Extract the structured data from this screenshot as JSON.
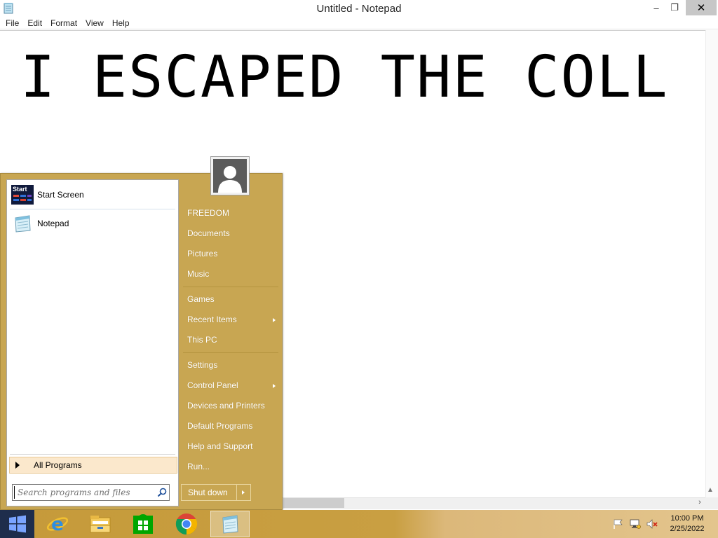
{
  "window": {
    "title": "Untitled - Notepad",
    "icon": "notepad-icon",
    "minimize_glyph": "–",
    "restore_glyph": "❐",
    "close_glyph": "✕"
  },
  "menubar": {
    "items": [
      "File",
      "Edit",
      "Format",
      "View",
      "Help"
    ]
  },
  "editor": {
    "text": "I ESCAPED THE COLL"
  },
  "start_menu": {
    "pinned": [
      {
        "label": "Start Screen",
        "icon": "start-screen-icon",
        "icon_text": "Start"
      },
      {
        "label": "Notepad",
        "icon": "notepad-icon"
      }
    ],
    "all_programs": "All Programs",
    "search": {
      "placeholder": "Search programs and files",
      "value": ""
    },
    "user_icon": "user-avatar-icon",
    "right_items": [
      {
        "label": "FREEDOM",
        "submenu": false
      },
      {
        "label": "Documents",
        "submenu": false
      },
      {
        "label": "Pictures",
        "submenu": false
      },
      {
        "label": "Music",
        "submenu": false
      },
      {
        "label": "Games",
        "submenu": false
      },
      {
        "label": "Recent Items",
        "submenu": true
      },
      {
        "label": "This PC",
        "submenu": false
      },
      {
        "label": "Settings",
        "submenu": false
      },
      {
        "label": "Control Panel",
        "submenu": true
      },
      {
        "label": "Devices and Printers",
        "submenu": false
      },
      {
        "label": "Default Programs",
        "submenu": false
      },
      {
        "label": "Help and Support",
        "submenu": false
      },
      {
        "label": "Run...",
        "submenu": false
      }
    ],
    "shutdown_label": "Shut down"
  },
  "taskbar": {
    "start_icon": "windows-logo-icon",
    "pinned_apps": [
      "internet-explorer-icon",
      "file-explorer-icon",
      "store-icon",
      "chrome-icon",
      "notepad-icon"
    ],
    "active_app": "notepad-icon",
    "tray_icons": [
      "action-center-flag-icon",
      "network-icon",
      "volume-muted-icon"
    ],
    "time": "10:00 PM",
    "date": "2/25/2022"
  },
  "colors": {
    "start_menu_bg": "#c8a652",
    "taskbar_bg": "#c59a3a",
    "start_button_bg": "#1e2d4c",
    "all_programs_highlight": "#fbe8cc"
  }
}
